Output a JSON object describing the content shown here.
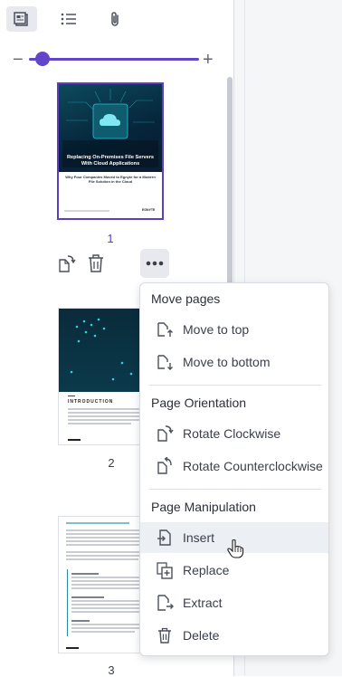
{
  "toolbar": {
    "tabs": [
      {
        "name": "thumbnails-icon",
        "active": true
      },
      {
        "name": "outline-icon",
        "active": false
      },
      {
        "name": "attachments-icon",
        "active": false
      }
    ]
  },
  "zoom": {
    "minus": "−",
    "plus": "+",
    "level_fraction": 0.08
  },
  "pages": [
    {
      "number": "1",
      "cover_title": "Replacing On-Premises File Servers With Cloud Applications",
      "cover_subtitle": "Why Four Companies Moved to Egnyte for a Modern File Solution in the Cloud",
      "brand": "EGNYTE"
    },
    {
      "number": "2",
      "heading": "INTRODUCTION"
    },
    {
      "number": "3"
    }
  ],
  "menu": {
    "sections": [
      {
        "title": "Move pages",
        "items": [
          "Move to top",
          "Move to bottom"
        ]
      },
      {
        "title": "Page Orientation",
        "items": [
          "Rotate Clockwise",
          "Rotate Counterclockwise"
        ]
      },
      {
        "title": "Page Manipulation",
        "items": [
          "Insert",
          "Replace",
          "Extract",
          "Delete"
        ]
      }
    ],
    "hovered_item": "Insert"
  },
  "colors": {
    "accent": "#6245c9",
    "selected_border": "#5a3fc1",
    "page_number": "#5a3fc1",
    "hover_bg": "#eceff3"
  }
}
